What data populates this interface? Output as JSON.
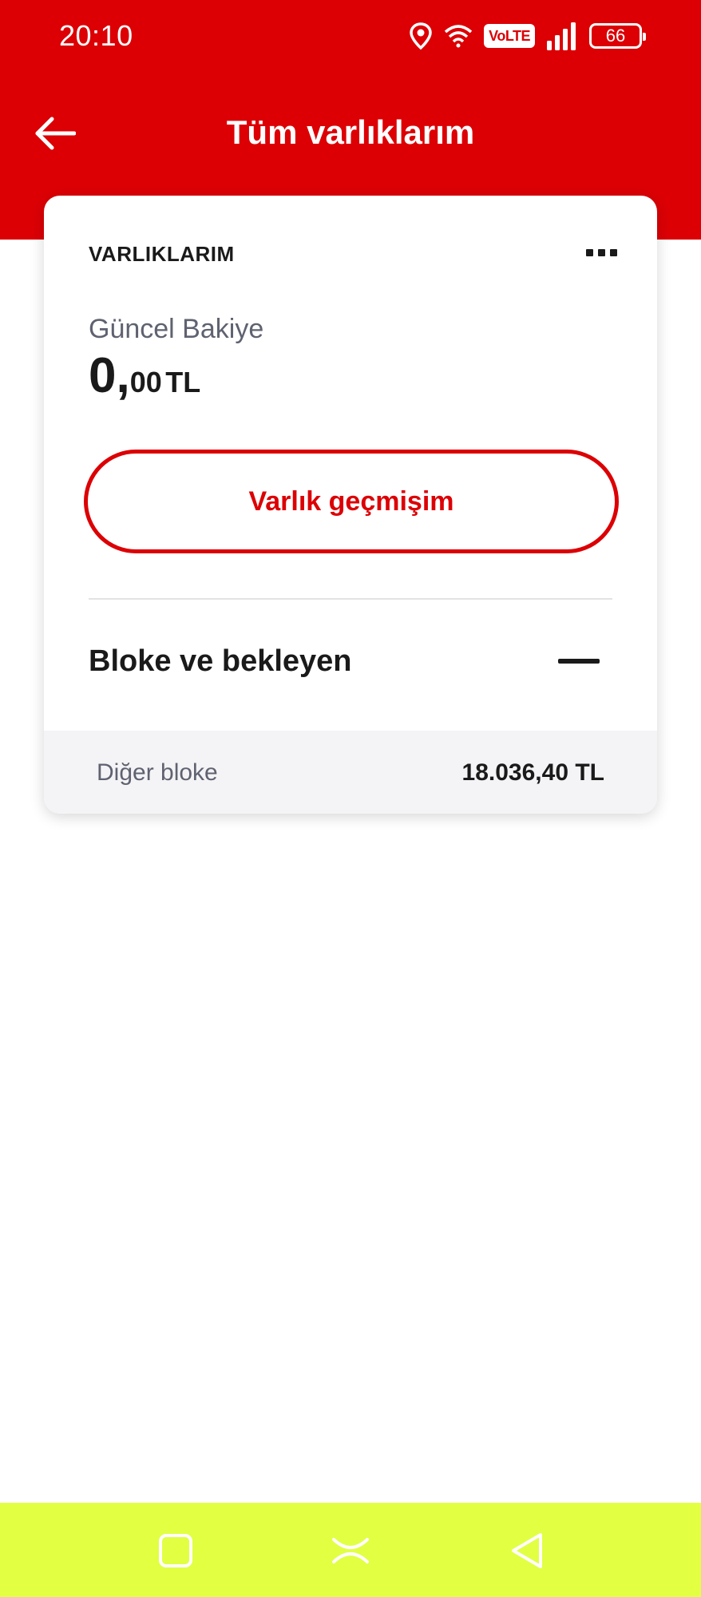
{
  "status_bar": {
    "time": "20:10",
    "volte": "VoLTE",
    "battery": "66",
    "icons": [
      "location-icon",
      "wifi-icon",
      "volte-badge",
      "signal-icon",
      "battery-icon"
    ]
  },
  "app_bar": {
    "title": "Tüm varlıklarım",
    "back_icon": "arrow-left-icon"
  },
  "card": {
    "title": "VARLIKLARIM",
    "more_icon": "more-horizontal-icon",
    "balance_label": "Güncel Bakiye",
    "balance_int": "0,",
    "balance_dec": "00",
    "balance_currency": "TL",
    "history_button": "Varlık geçmişim",
    "section_title": "Bloke ve bekleyen",
    "collapse_icon": "minus-icon",
    "detail": {
      "label": "Diğer bloke",
      "value": "18.036,40 TL"
    }
  },
  "colors": {
    "brand_red": "#dc0005",
    "nav_bar": "#e2ff42"
  },
  "nav_bar": {
    "icons": [
      "recent-apps-icon",
      "home-icon",
      "back-triangle-icon"
    ]
  }
}
